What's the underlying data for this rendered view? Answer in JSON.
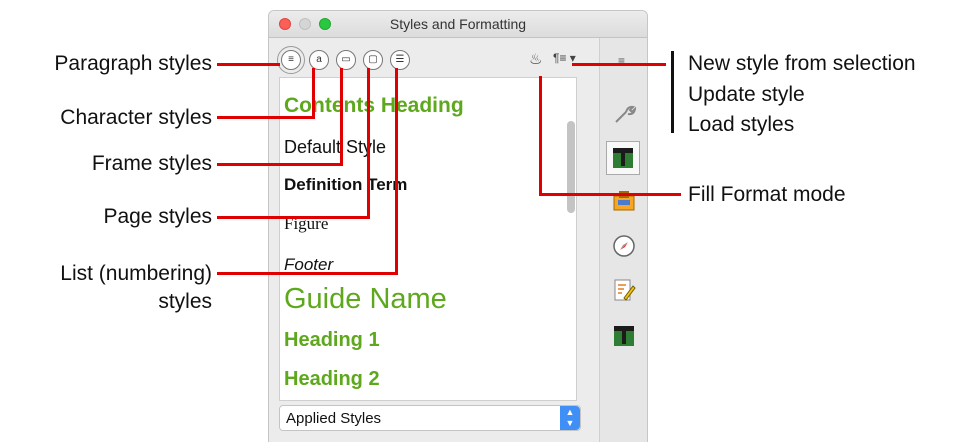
{
  "window": {
    "title": "Styles and Formatting",
    "traffic_lights": [
      "close",
      "minimize",
      "zoom"
    ]
  },
  "toolbar": {
    "style_buttons": [
      "paragraph-styles-icon",
      "character-styles-icon",
      "frame-styles-icon",
      "page-styles-icon",
      "list-styles-icon"
    ],
    "selected": "paragraph-styles-icon",
    "right_buttons": [
      "fill-format-mode-icon",
      "new-style-menu-icon"
    ],
    "sidebar_menu_icon": "menu-icon"
  },
  "styles": [
    {
      "label": "Contents Heading"
    },
    {
      "label": "Default Style"
    },
    {
      "label": "Definition Term"
    },
    {
      "label": "Figure"
    },
    {
      "label": "Footer"
    },
    {
      "label": "Guide Name"
    },
    {
      "label": "Heading 1"
    },
    {
      "label": "Heading 2"
    }
  ],
  "filter": {
    "value": "Applied Styles"
  },
  "callouts": {
    "paragraph_styles": "Paragraph styles",
    "character_styles": "Character styles",
    "frame_styles": "Frame styles",
    "page_styles": "Page styles",
    "list_styles_line1": "List (numbering)",
    "list_styles_line2": "styles",
    "new_style": "New style from selection",
    "update_style": "Update style",
    "load_styles": "Load styles",
    "fill_format": "Fill Format mode"
  },
  "colors": {
    "callout_line": "#e00000",
    "heading_green": "#5ea81d",
    "traffic_red": "#fc5f57",
    "traffic_green": "#2ac840",
    "dropdown_blue": "#3f8ff7"
  },
  "sidebar": {
    "icons": [
      "properties-icon",
      "styles-icon",
      "gallery-icon",
      "navigator-icon",
      "manage-changes-icon",
      "styles-alt-icon"
    ]
  }
}
